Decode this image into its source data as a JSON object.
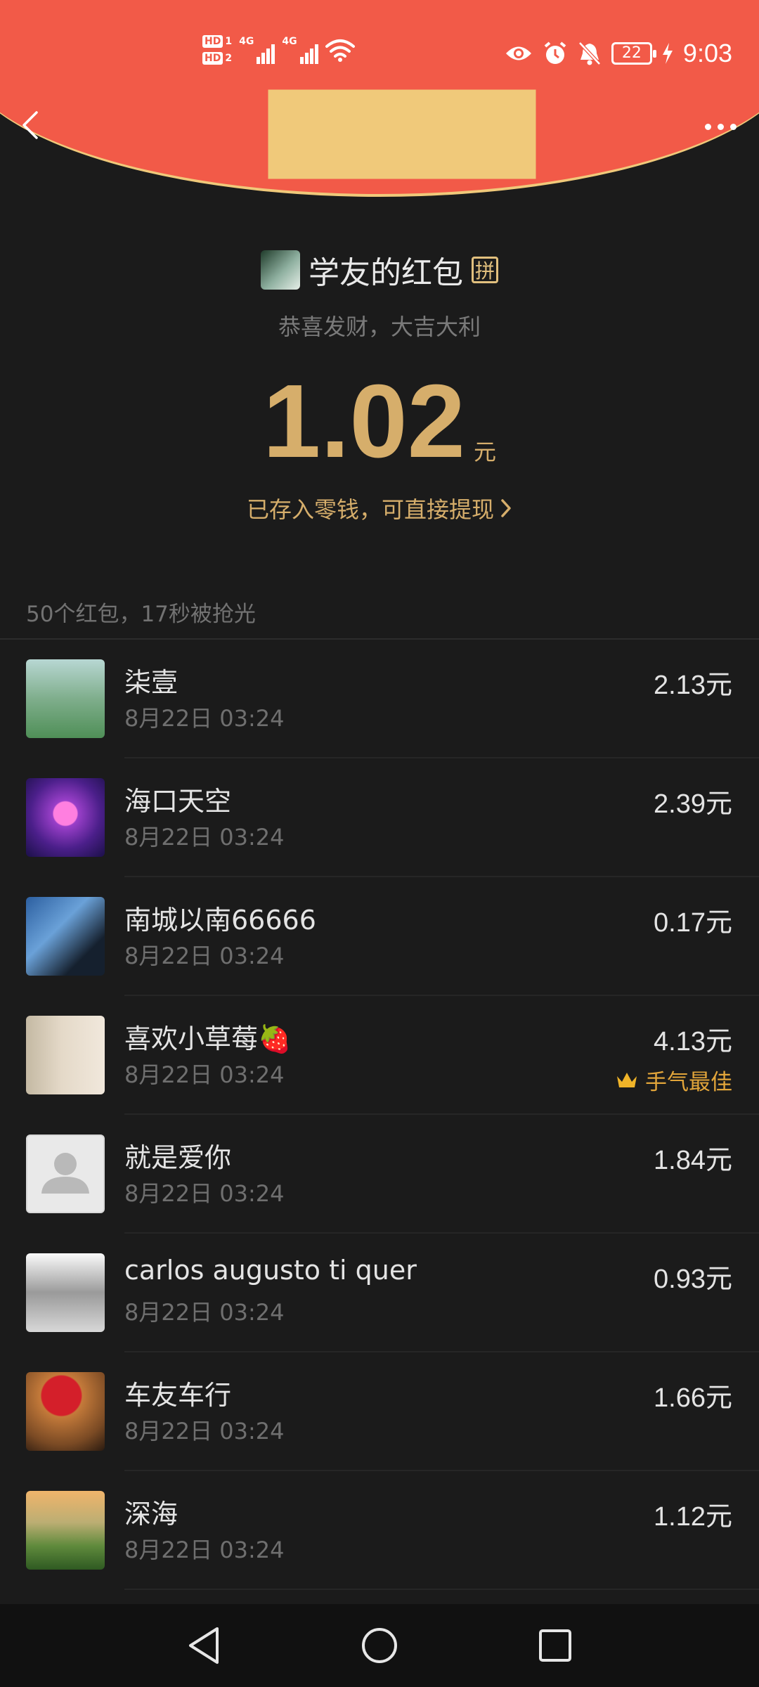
{
  "status_bar": {
    "sim1": "HD",
    "sim1_num": "1",
    "sim2": "HD",
    "sim2_num": "2",
    "network1": "4G",
    "network2": "4G",
    "battery": "22",
    "time": "9:03"
  },
  "colors": {
    "header_red": "#f25a48",
    "gold": "#d6ae6b",
    "background": "#1b1b1b"
  },
  "header": {
    "sender_name": "学友的红包",
    "pin_badge": "拼",
    "greeting": "恭喜发财，大吉大利",
    "amount": "1.02",
    "amount_unit": "元",
    "stored_text": "已存入零钱，可直接提现"
  },
  "summary": "50个红包，17秒被抢光",
  "list": [
    {
      "name": "柒壹",
      "time": "8月22日  03:24",
      "amount": "2.13元"
    },
    {
      "name": "海口天空",
      "time": "8月22日  03:24",
      "amount": "2.39元"
    },
    {
      "name": "南城以南66666",
      "time": "8月22日  03:24",
      "amount": "0.17元"
    },
    {
      "name": "喜欢小草莓🍓",
      "time": "8月22日  03:24",
      "amount": "4.13元",
      "best": "手气最佳"
    },
    {
      "name": "就是爱你",
      "time": "8月22日  03:24",
      "amount": "1.84元"
    },
    {
      "name": "carlos augusto ti quer",
      "time": "8月22日  03:24",
      "amount": "0.93元"
    },
    {
      "name": "车友车行",
      "time": "8月22日  03:24",
      "amount": "1.66元"
    },
    {
      "name": "深海",
      "time": "8月22日  03:24",
      "amount": "1.12元"
    }
  ]
}
